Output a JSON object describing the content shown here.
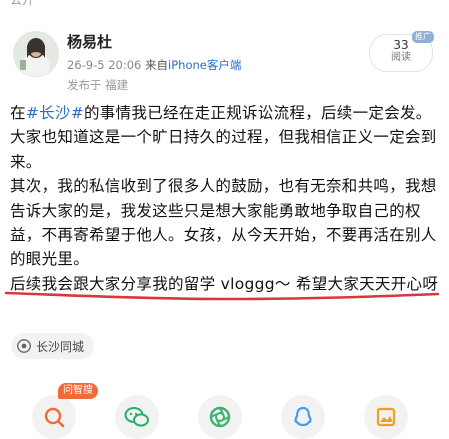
{
  "header": {
    "partial_label": "公开"
  },
  "user": {
    "name": "杨易杜",
    "timestamp": "26-9-5 20:06",
    "source_prefix": "来自",
    "client": "iPhone客户端",
    "location_label": "发布于 福建"
  },
  "reads": {
    "count": "33",
    "label": "阅读",
    "promo_badge": "推广"
  },
  "post": {
    "para1_pre": "在",
    "hashtag": "#长沙#",
    "para1_post": "的事情我已经在走正规诉讼流程，后续一定会发。大家也知道这是一个旷日持久的过程，但我相信正义一定会到来。",
    "para2": "其次，我的私信收到了很多人的鼓励，也有无奈和共鸣，我想告诉大家的是，我发这些只是想大家能勇敢地争取自己的权益，不再寄希望于他人。女孩，从今天开始，不要再活在别人的眼光里。",
    "para3": "后续我会跟大家分享我的留学 vloggg～ 希望大家天天开心呀"
  },
  "location_chip": {
    "label": "长沙同城"
  },
  "share": {
    "qa_badge": "问智搜",
    "buttons": [
      "search-share",
      "wechat",
      "moments",
      "qq",
      "album"
    ]
  },
  "colors": {
    "link": "#2c6cc4",
    "underline": "#d9363e",
    "badge": "#f06a3a",
    "wechat": "#2aae67",
    "moments": "#3cb371",
    "qq": "#3d9df5",
    "album": "#f0a020"
  }
}
